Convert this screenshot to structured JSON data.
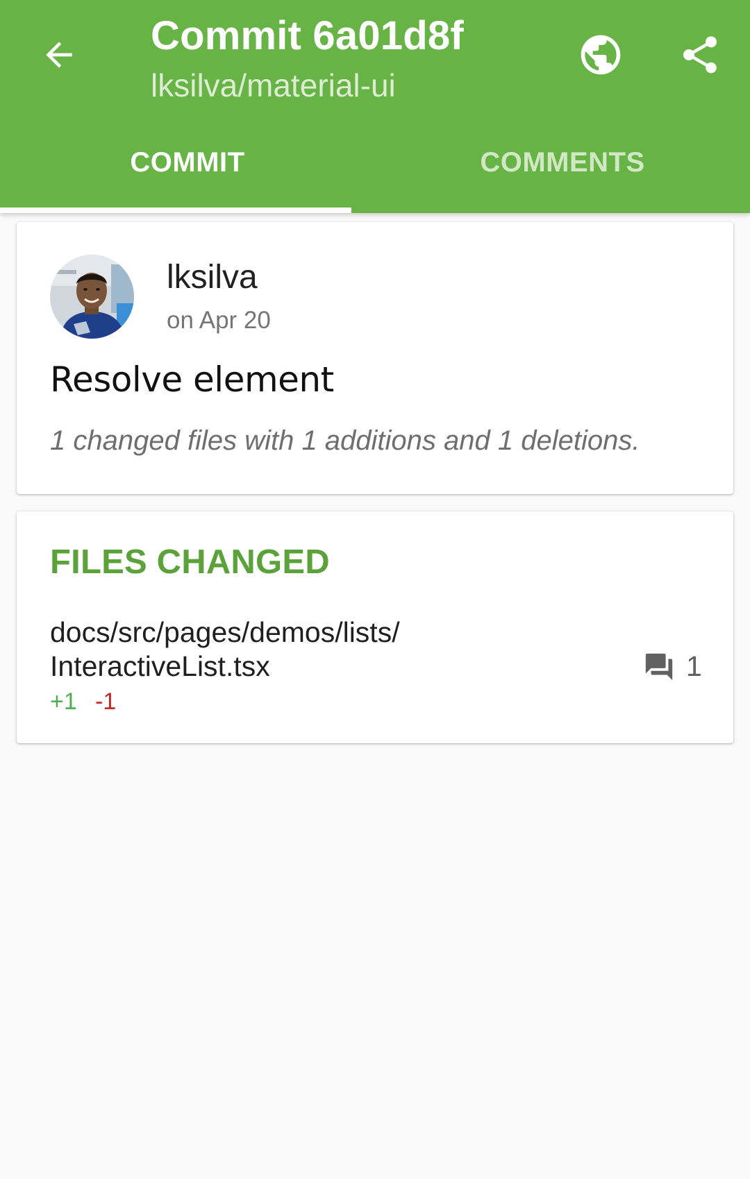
{
  "header": {
    "title": "Commit 6a01d8f",
    "subtitle": "lksilva/material-ui",
    "color": "#67b346",
    "icons": [
      "arrow-back-icon",
      "globe-icon",
      "share-icon"
    ]
  },
  "tabs": [
    {
      "label": "COMMIT",
      "selected": true
    },
    {
      "label": "COMMENTS",
      "selected": false
    }
  ],
  "commit": {
    "author": "lksilva",
    "date": "on Apr 20",
    "message": "Resolve element",
    "summary": "1 changed files with 1 additions and 1 deletions."
  },
  "files": {
    "heading": "FILES CHANGED",
    "items": [
      {
        "path_line1": "docs/src/pages/demos/lists/",
        "path_line2": "InteractiveList.tsx",
        "additions": "+1",
        "deletions": "-1",
        "comments": "1",
        "comment_icon": "comments-icon"
      }
    ]
  }
}
